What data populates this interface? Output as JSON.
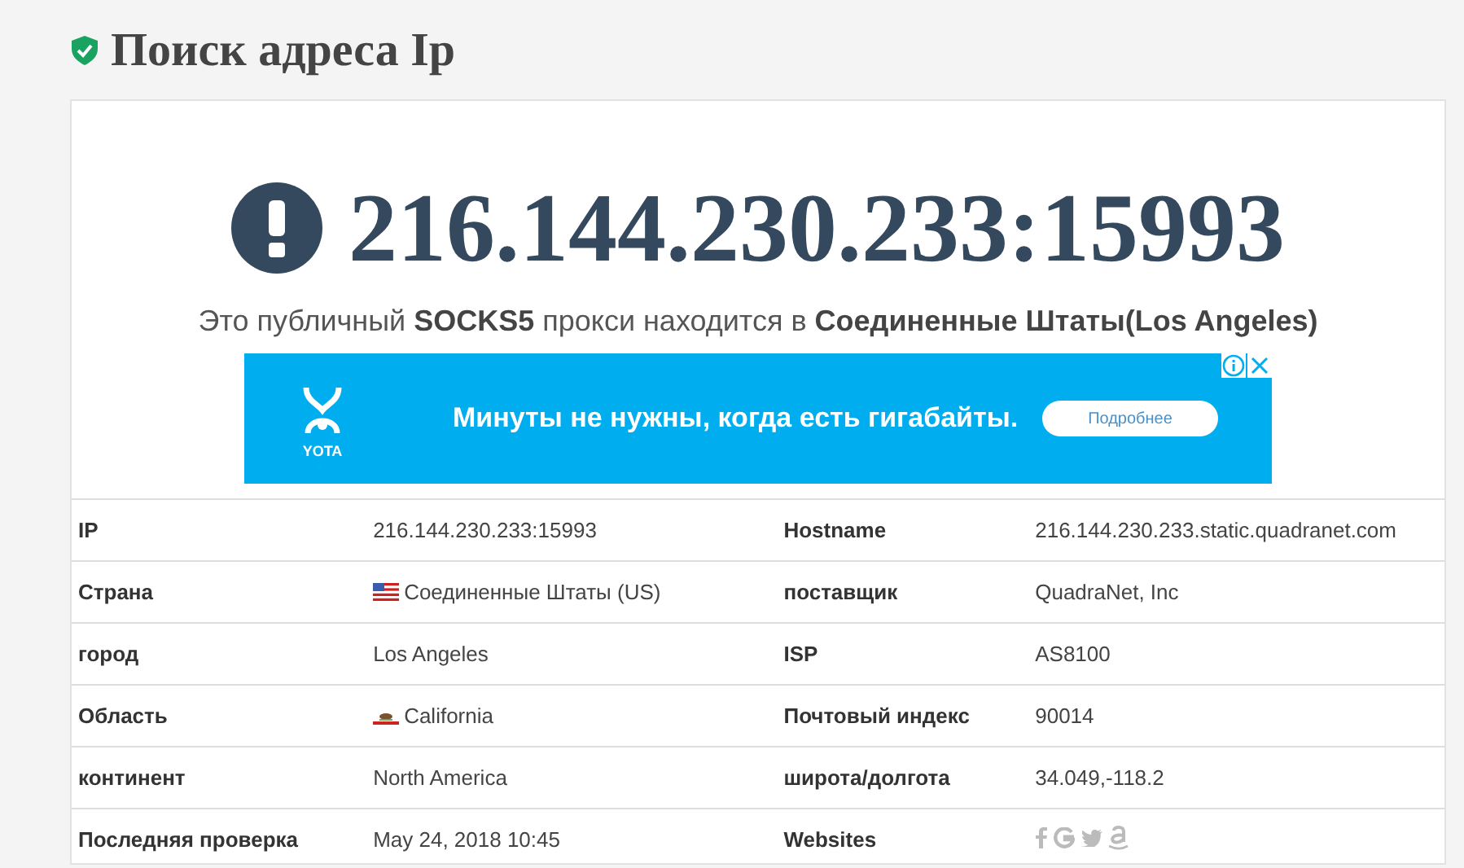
{
  "page_title": "Поиск адреса Ip",
  "address": "216.144.230.233:15993",
  "summary": "Это публичный **SOCKS5** прокси находится в **Соединенные Штаты(Los Angeles)**",
  "ad": {
    "brand": "YOTA",
    "slogan": "Минуты не нужны, когда есть гигабайты.",
    "button": "Подробнее"
  },
  "rows": [
    {
      "cells": [
        {
          "label": "IP",
          "value": "216.144.230.233:15993"
        },
        {
          "label": "Hostname",
          "value": "216.144.230.233.static.quadranet.com"
        }
      ]
    },
    {
      "cells": [
        {
          "label": "Страна",
          "value": "Соединенные Штаты (US)",
          "kind": "us-flag"
        },
        {
          "label": "поставщик",
          "value": "QuadraNet, Inc"
        }
      ]
    },
    {
      "cells": [
        {
          "label": "город",
          "value": "Los Angeles"
        },
        {
          "label": "ISP",
          "value": "AS8100"
        }
      ]
    },
    {
      "cells": [
        {
          "label": "Область",
          "value": "California",
          "kind": "california-flag"
        },
        {
          "label": "Почтовый индекс",
          "value": "90014"
        }
      ]
    },
    {
      "cells": [
        {
          "label": "континент",
          "value": "North America"
        },
        {
          "label": "широта/долгота",
          "value": "34.049,-118.2"
        }
      ]
    },
    {
      "cells": [
        {
          "label": "Последняя проверка",
          "value": "May 24, 2018 10:45"
        },
        {
          "label": "Websites",
          "kind": "site-icons"
        }
      ]
    }
  ]
}
